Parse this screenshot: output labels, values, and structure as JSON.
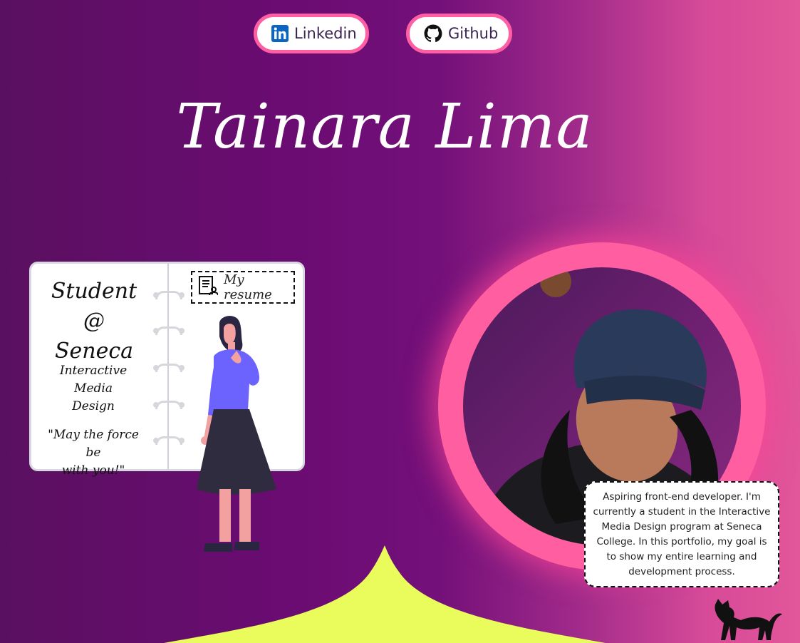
{
  "nav": {
    "linkedin_label": "Linkedin",
    "github_label": "Github"
  },
  "hero": {
    "name": "Tainara Lima"
  },
  "notebook": {
    "line1": "Student",
    "line2": "@ Seneca",
    "program_line1": "Interactive Media",
    "program_line2": "Design",
    "quote_line1": "\"May the force be",
    "quote_line2": "with you!\"",
    "resume_label": "My resume"
  },
  "bio": {
    "text": "Aspiring front-end developer. I'm currently a student in the Interactive Media Design program at Seneca College. In this portfolio, my goal is to show my entire learning and development process."
  },
  "colors": {
    "accent_pink": "#ff5fa2",
    "wave_yellow": "#eafc5c",
    "bg_purple": "#6a0c72"
  },
  "icons": [
    "linkedin-icon",
    "github-icon",
    "resume-icon",
    "cat-icon"
  ]
}
